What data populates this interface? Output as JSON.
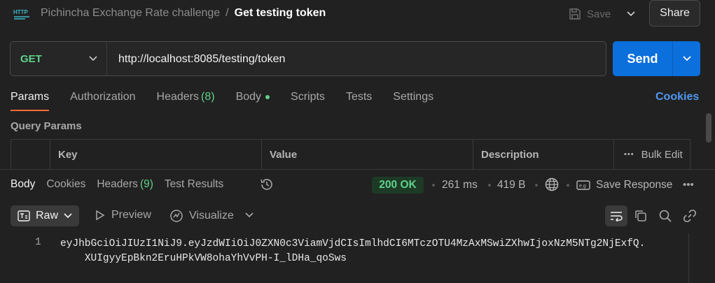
{
  "header": {
    "collection": "Pichincha Exchange Rate challenge",
    "separator": "/",
    "request_name": "Get testing token",
    "save_label": "Save",
    "share_label": "Share"
  },
  "request": {
    "method": "GET",
    "url": "http://localhost:8085/testing/token",
    "send_label": "Send"
  },
  "request_tabs": [
    {
      "label": "Params",
      "active": true
    },
    {
      "label": "Authorization"
    },
    {
      "label": "Headers",
      "count": "(8)"
    },
    {
      "label": "Body",
      "has_dot": true
    },
    {
      "label": "Scripts"
    },
    {
      "label": "Tests"
    },
    {
      "label": "Settings"
    }
  ],
  "cookies_label": "Cookies",
  "query_params": {
    "title": "Query Params",
    "columns": {
      "key": "Key",
      "value": "Value",
      "description": "Description"
    },
    "bulk_edit": "Bulk Edit"
  },
  "response": {
    "tabs": [
      {
        "label": "Body",
        "active": true
      },
      {
        "label": "Cookies"
      },
      {
        "label": "Headers",
        "count": "(9)"
      },
      {
        "label": "Test Results"
      }
    ],
    "status": "200 OK",
    "time": "261 ms",
    "size": "419 B",
    "save_response": "Save Response",
    "format": "Raw",
    "preview": "Preview",
    "visualize": "Visualize",
    "line_number": "1",
    "body_line1": "eyJhbGciOiJIUzI1NiJ9.eyJzdWIiOiJ0ZXN0c3ViamVjdCIsImlhdCI6MTczOTU4MzAxMSwiZXhwIjoxNzM5NTg2NjExfQ.",
    "body_line2": "XUIgyyEpBkn2EruHPkVW8ohaYhVvPH-I_lDHa_qoSws"
  },
  "colors": {
    "accent": "#0b6fdc",
    "method_green": "#5fd18b",
    "tab_underline": "#ff6c37",
    "link_blue": "#4f98f0"
  }
}
